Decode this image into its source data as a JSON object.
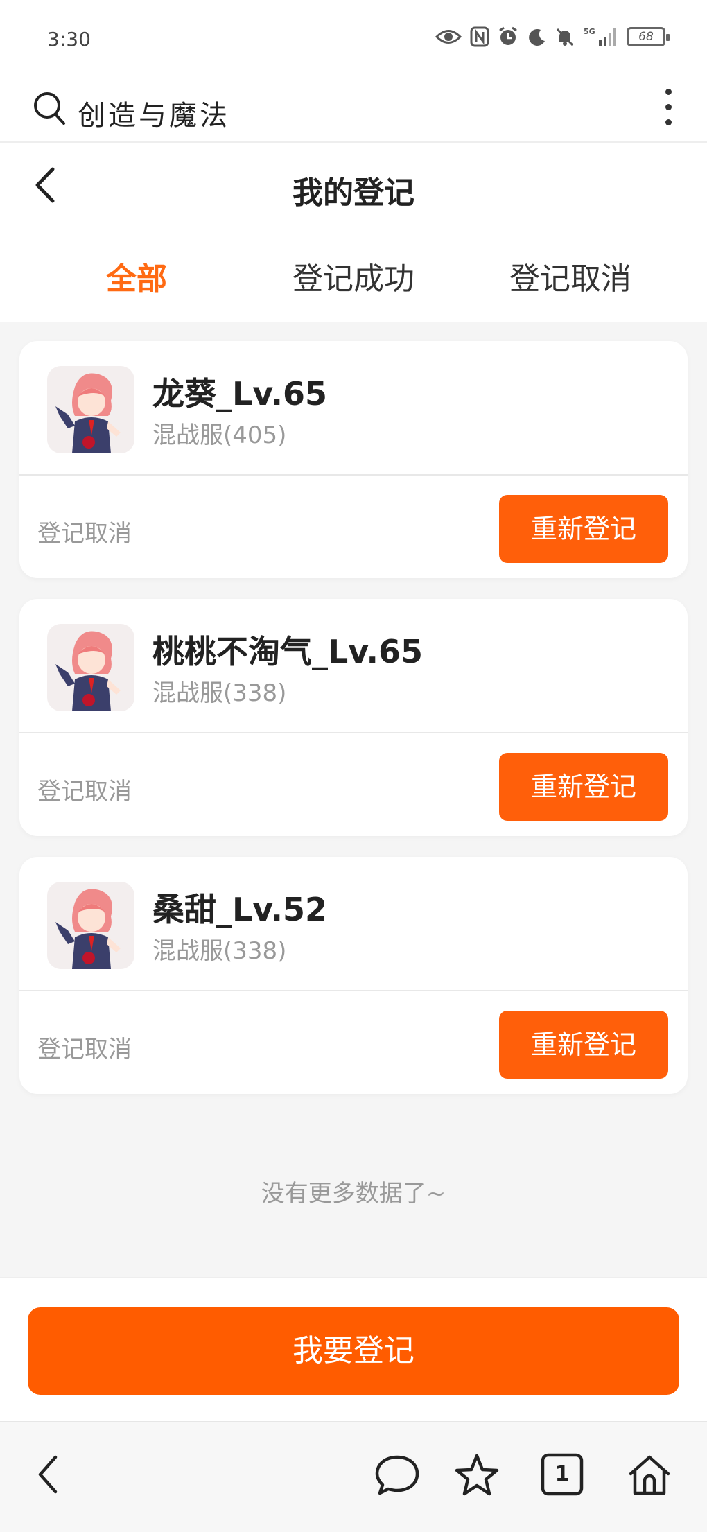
{
  "status_bar": {
    "time": "3:30",
    "battery": "68"
  },
  "search": {
    "query": "创造与魔法"
  },
  "header": {
    "title": "我的登记"
  },
  "tabs": [
    {
      "label": "全部",
      "active": true
    },
    {
      "label": "登记成功",
      "active": false
    },
    {
      "label": "登记取消",
      "active": false
    }
  ],
  "records": [
    {
      "name": "龙葵_Lv.65",
      "server": "混战服(405)",
      "status": "登记取消",
      "action": "重新登记"
    },
    {
      "name": "桃桃不淘气_Lv.65",
      "server": "混战服(338)",
      "status": "登记取消",
      "action": "重新登记"
    },
    {
      "name": "桑甜_Lv.52",
      "server": "混战服(338)",
      "status": "登记取消",
      "action": "重新登记"
    }
  ],
  "list_end_text": "没有更多数据了~",
  "footer": {
    "register_label": "我要登记"
  },
  "browser_nav": {
    "tab_count": "1"
  },
  "colors": {
    "accent": "#ff5f0a",
    "active_tab": "#ff6a13"
  }
}
